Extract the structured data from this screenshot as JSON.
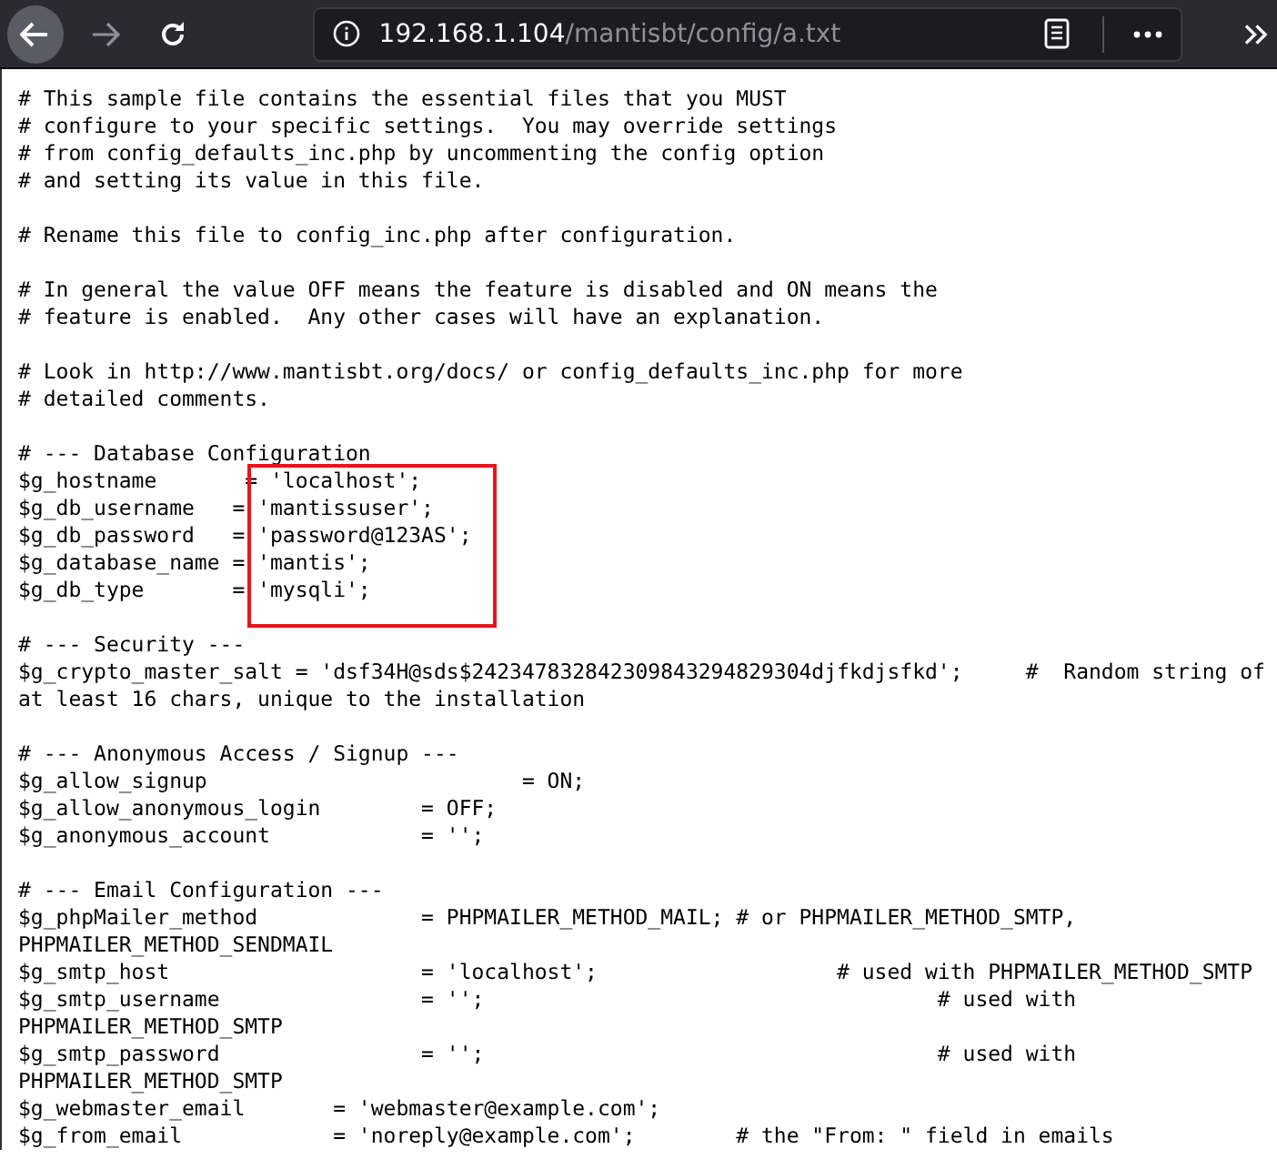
{
  "toolbar": {
    "back": {
      "hovered": true
    },
    "forward": {
      "disabled": true
    },
    "url": {
      "host": "192.168.1.104",
      "path": "/mantisbt/config/a.txt"
    }
  },
  "blocks": [
    {
      "lines": [
        {
          "text": "# This sample file contains the essential files that you MUST"
        },
        {
          "text": "# configure to your specific settings.  You may override settings"
        },
        {
          "text": "# from config_defaults_inc.php by uncommenting the config option"
        },
        {
          "text": "# and setting its value in this file."
        }
      ]
    },
    {
      "lines": [
        {
          "text": "# Rename this file to config_inc.php after configuration."
        }
      ]
    },
    {
      "lines": [
        {
          "text": "# In general the value OFF means the feature is disabled and ON means the"
        },
        {
          "text": "# feature is enabled.  Any other cases will have an explanation."
        }
      ]
    },
    {
      "lines": [
        {
          "text": "# Look in http://www.mantisbt.org/docs/ or config_defaults_inc.php for more"
        },
        {
          "text": "# detailed comments."
        }
      ]
    },
    {
      "lines": [
        {
          "text": "# --- Database Configuration",
          "boxed": false
        },
        {
          "text": "$g_hostname       = 'localhost';",
          "boxed": true
        },
        {
          "text": "$g_db_username   = 'mantissuser';",
          "boxed": true
        },
        {
          "text": "$g_db_password   = 'password@123AS';",
          "boxed": true
        },
        {
          "text": "$g_database_name = 'mantis';",
          "boxed": true
        },
        {
          "text": "$g_db_type       = 'mysqli';",
          "boxed": true
        }
      ]
    },
    {
      "lines": [
        {
          "text": "# --- Security ---"
        },
        {
          "text": "$g_crypto_master_salt = 'dsf34H@sds$242347832842309843294829304djfkdjsfkd';     #  Random string of"
        },
        {
          "text": "at least 16 chars, unique to the installation"
        }
      ]
    },
    {
      "lines": [
        {
          "text": "# --- Anonymous Access / Signup ---"
        },
        {
          "text": "$g_allow_signup                         = ON;"
        },
        {
          "text": "$g_allow_anonymous_login        = OFF;"
        },
        {
          "text": "$g_anonymous_account            = '';"
        }
      ]
    },
    {
      "lines": [
        {
          "text": "# --- Email Configuration ---"
        },
        {
          "text": "$g_phpMailer_method             = PHPMAILER_METHOD_MAIL; # or PHPMAILER_METHOD_SMTP,"
        },
        {
          "text": "PHPMAILER_METHOD_SENDMAIL"
        },
        {
          "text": "$g_smtp_host                    = 'localhost';                   # used with PHPMAILER_METHOD_SMTP"
        },
        {
          "text": "$g_smtp_username                = '';                                    # used with"
        },
        {
          "text": "PHPMAILER_METHOD_SMTP"
        },
        {
          "text": "$g_smtp_password                = '';                                    # used with"
        },
        {
          "text": "PHPMAILER_METHOD_SMTP"
        },
        {
          "text": "$g_webmaster_email       = 'webmaster@example.com';"
        },
        {
          "text": "$g_from_email            = 'noreply@example.com';        # the \"From: \" field in emails"
        }
      ]
    }
  ]
}
